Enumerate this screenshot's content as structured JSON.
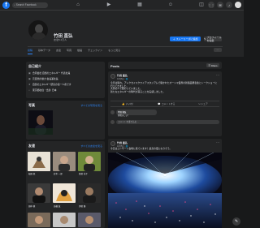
{
  "nav": {
    "search_placeholder": "Search Facebook",
    "icons": [
      "home-icon",
      "watch-icon",
      "marketplace-icon",
      "groups-icon",
      "gaming-icon"
    ],
    "right_icons": [
      "menu-icon",
      "messenger-icon",
      "notifications-icon",
      "account-icon"
    ]
  },
  "profile": {
    "name": "竹田 直弘",
    "friends": "友達5.4万人",
    "add_story_label": "ストーリーズに追加",
    "edit_profile_label": "プロフィールを編集"
  },
  "tabs": [
    "投稿",
    "基本データ",
    "友達",
    "写真",
    "動画",
    "チェックイン",
    "もっと見る"
  ],
  "intro": {
    "title": "自己紹介",
    "items": [
      "合同会社 自然のエネルギー 代表社員",
      "元自然の動力 会長兼社長",
      "自然のエネルギー研究の第一人者です",
      "東京都在住・出身: 日本"
    ]
  },
  "photos": {
    "title": "写真",
    "see_all": "すべての写真を見る"
  },
  "friends": {
    "title": "友達",
    "see_all": "すべての友達を見る",
    "names": [
      "松田 進",
      "鈴木 一郎",
      "佐藤 花子",
      "田中 健",
      "高橋 誠",
      "伊藤 優"
    ]
  },
  "posts": {
    "title": "Posts",
    "filter_label": "Filters",
    "post1": {
      "author": "竹田 直弘",
      "time": "10月6日 · 🌐",
      "text": "今日は晴れ。アレクセイスクワイアスタジアムで開かれたオートマ業界の新製品発表会とトークショーに行ってきました。\n大勢の人で賑わっていました。\n新たなエネルギーの時代が来ることを実感しました。",
      "like": "いいね！",
      "comment": "コメントする",
      "share": "シェア",
      "comment_placeholder": "コメントを書き込む…",
      "reply_author": "竹田 直弘",
      "reply_text": "素晴らしい！"
    },
    "post2": {
      "author": "竹田 直弘",
      "time": "10月5日 · 🌐",
      "text": "今日はコンサート会場に来ています！最高の夜になりそう。"
    }
  }
}
